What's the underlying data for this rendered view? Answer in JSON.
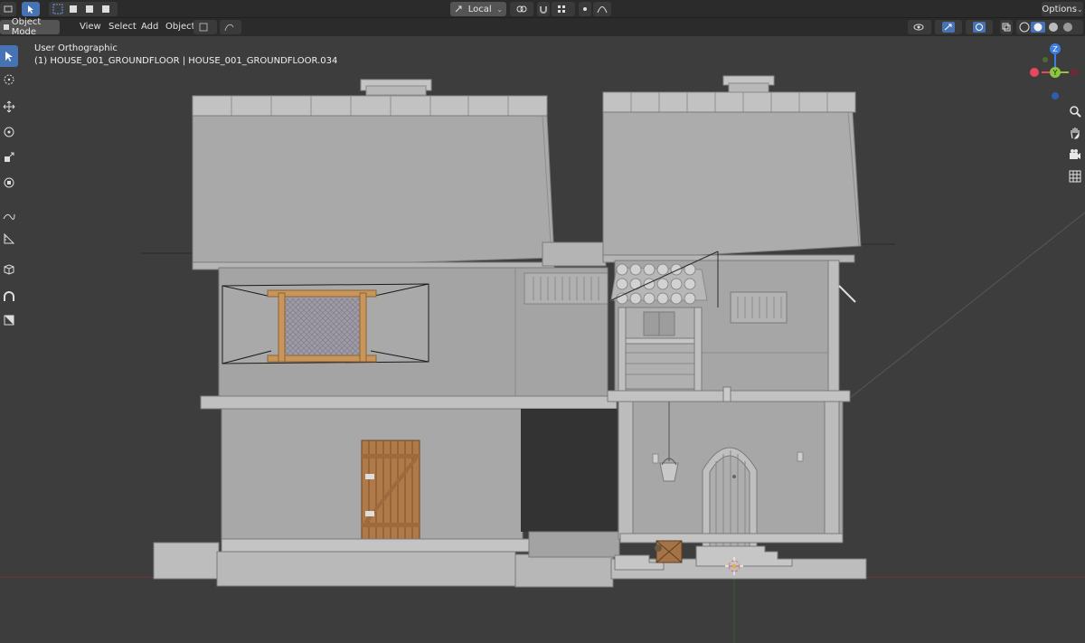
{
  "header": {
    "transform_orientation": "Local",
    "options_label": "Options"
  },
  "menubar": {
    "mode": "Object Mode",
    "items": [
      "View",
      "Select",
      "Add",
      "Object"
    ]
  },
  "viewport": {
    "view_name": "User Orthographic",
    "object_info": "(1) HOUSE_001_GROUNDFLOOR | HOUSE_001_GROUNDFLOOR.034"
  },
  "gizmo": {
    "z_label": "Z",
    "y_label": "Y",
    "colors": {
      "x": "#e8475d",
      "y": "#8cc63f",
      "z": "#3d7ee0"
    }
  },
  "tools": [
    {
      "icon": "select-box-icon"
    },
    {
      "icon": "cursor-icon"
    },
    {
      "icon": "move-icon"
    },
    {
      "icon": "rotate-icon"
    },
    {
      "icon": "scale-icon"
    },
    {
      "icon": "transform-icon"
    },
    {
      "icon": "annotate-icon"
    },
    {
      "icon": "measure-icon"
    },
    {
      "icon": "add-cube-icon"
    },
    {
      "icon": "spin-icon"
    },
    {
      "icon": "shear-icon"
    }
  ],
  "nav": [
    {
      "icon": "zoom-icon"
    },
    {
      "icon": "pan-hand-icon"
    },
    {
      "icon": "camera-icon"
    },
    {
      "icon": "grid-icon"
    }
  ]
}
